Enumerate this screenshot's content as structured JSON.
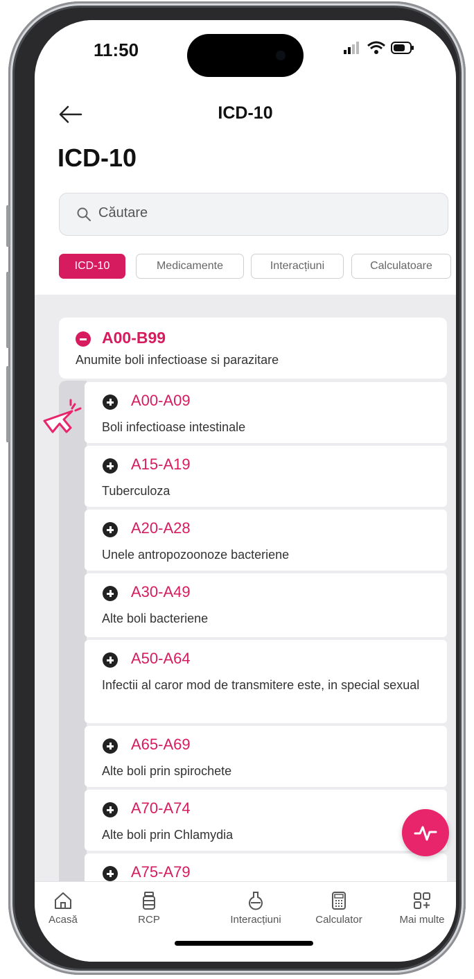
{
  "status_bar": {
    "time": "11:50"
  },
  "nav": {
    "title": "ICD-10"
  },
  "page": {
    "title": "ICD-10"
  },
  "search": {
    "placeholder": "Căutare"
  },
  "chips": [
    "ICD-10",
    "Medicamente",
    "Interacțiuni",
    "Calculatoare"
  ],
  "group": {
    "code": "A00-B99",
    "description": "Anumite boli infectioase si parazitare"
  },
  "items": [
    {
      "code": "A00-A09",
      "description": "Boli infectioase intestinale"
    },
    {
      "code": "A15-A19",
      "description": "Tuberculoza"
    },
    {
      "code": "A20-A28",
      "description": "Unele antropozoonoze bacteriene"
    },
    {
      "code": "A30-A49",
      "description": "Alte boli bacteriene"
    },
    {
      "code": "A50-A64",
      "description": "Infectii al caror mod de transmitere este, in special sexual"
    },
    {
      "code": "A65-A69",
      "description": "Alte boli prin spirochete"
    },
    {
      "code": "A70-A74",
      "description": "Alte boli prin Chlamydia"
    },
    {
      "code": "A75-A79",
      "description": ""
    }
  ],
  "tabbar": {
    "tabs": [
      {
        "label": "Acasă",
        "icon": "home-icon"
      },
      {
        "label": "RCP",
        "icon": "pill-bottle-icon"
      },
      {
        "label": "Interacțiuni",
        "icon": "flask-icon"
      },
      {
        "label": "Calculator",
        "icon": "calculator-icon"
      },
      {
        "label": "Mai multe",
        "icon": "grid-plus-icon"
      }
    ]
  },
  "colors": {
    "accent": "#d61c5e",
    "fab": "#e8246a"
  }
}
